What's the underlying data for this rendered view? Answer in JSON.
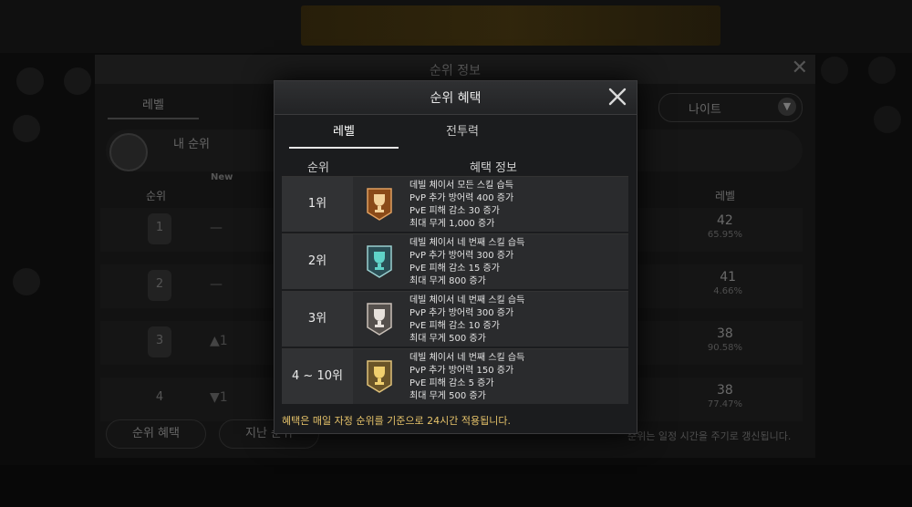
{
  "background": {
    "window_title": "순위 정보",
    "tab_level": "레벨",
    "my_rank_label": "내 순위",
    "new_badge": "New",
    "col_rank": "순위",
    "col_level": "레벨",
    "class_select": "나이트",
    "rows": [
      {
        "rank": "1",
        "change": "—",
        "level": "42",
        "percent": "65.95%"
      },
      {
        "rank": "2",
        "change": "—",
        "level": "41",
        "percent": "4.66%"
      },
      {
        "rank": "3",
        "change": "▲1",
        "level": "38",
        "percent": "90.58%"
      },
      {
        "rank": "4",
        "change": "▼1",
        "level": "38",
        "percent": "77.47%"
      }
    ],
    "button_rank_reward": "순위 혜택",
    "button_last_rank": "지난 순위",
    "footer_note": "순위는 일정 시간을 주기로 갱신됩니다."
  },
  "modal": {
    "title": "순위 혜택",
    "tabs": [
      {
        "label": "레벨",
        "active": true
      },
      {
        "label": "전투력",
        "active": false
      }
    ],
    "col_rank": "순위",
    "col_benefit": "혜택 정보",
    "rewards": [
      {
        "rank": "1위",
        "medal": "gold-trophy-medal",
        "color": "#c8742a",
        "lines": [
          "데빌 체이서 모든 스킬 습득",
          "PvP 추가 방어력 400 증가",
          "PvE 피해 감소 30 증가",
          "최대 무게 1,000 증가"
        ]
      },
      {
        "rank": "2위",
        "medal": "teal-trophy-medal",
        "color": "#3aa6a0",
        "lines": [
          "데빌 체이서 네 번째 스킬 습득",
          "PvP 추가 방어력 300 증가",
          "PvE 피해 감소 15 증가",
          "최대 무게 800 증가"
        ]
      },
      {
        "rank": "3위",
        "medal": "silver-trophy-medal",
        "color": "#9a9a9a",
        "lines": [
          "데빌 체이서 네 번째 스킬 습득",
          "PvP 추가 방어력 300 증가",
          "PvE 피해 감소 10 증가",
          "최대 무게 500 증가"
        ]
      },
      {
        "rank": "4 ~ 10위",
        "medal": "gold-small-trophy-medal",
        "color": "#c99a3a",
        "lines": [
          "데빌 체이서 네 번째 스킬 습득",
          "PvP 추가 방어력 150 증가",
          "PvE 피해 감소 5 증가",
          "최대 무게 500 증가"
        ]
      }
    ],
    "note": "혜택은 매일 자정 순위를 기준으로 24시간 적용됩니다.",
    "accent_note_color": "#e6c36a"
  }
}
